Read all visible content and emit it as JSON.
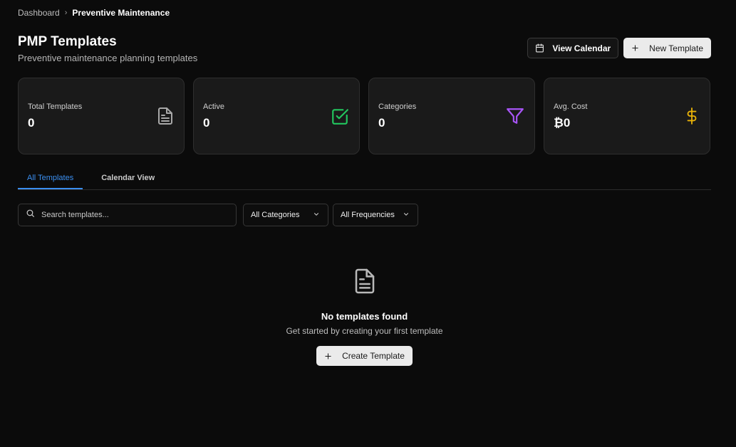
{
  "breadcrumb": {
    "root": "Dashboard",
    "separator": "›",
    "current": "Preventive Maintenance"
  },
  "header": {
    "title": "PMP Templates",
    "subtitle": "Preventive maintenance planning templates",
    "view_calendar_label": "View Calendar",
    "new_template_label": "New Template"
  },
  "stats": [
    {
      "label": "Total Templates",
      "value": "0",
      "icon": "document-icon",
      "color": "#a8a8a8"
    },
    {
      "label": "Active",
      "value": "0",
      "icon": "check-square-icon",
      "color": "#22c55e"
    },
    {
      "label": "Categories",
      "value": "0",
      "icon": "filter-icon",
      "color": "#a855f7"
    },
    {
      "label": "Avg. Cost",
      "value": "₿0",
      "icon": "dollar-icon",
      "color": "#eab308"
    }
  ],
  "tabs": [
    {
      "label": "All Templates",
      "active": true
    },
    {
      "label": "Calendar View",
      "active": false
    }
  ],
  "filters": {
    "search_placeholder": "Search templates...",
    "category_selected": "All Categories",
    "frequency_selected": "All Frequencies"
  },
  "empty_state": {
    "title": "No templates found",
    "subtitle": "Get started by creating your first template",
    "button_label": "Create Template"
  },
  "colors": {
    "accent": "#3b8ff0",
    "background": "#0b0b0b",
    "card": "#1a1a1a"
  }
}
